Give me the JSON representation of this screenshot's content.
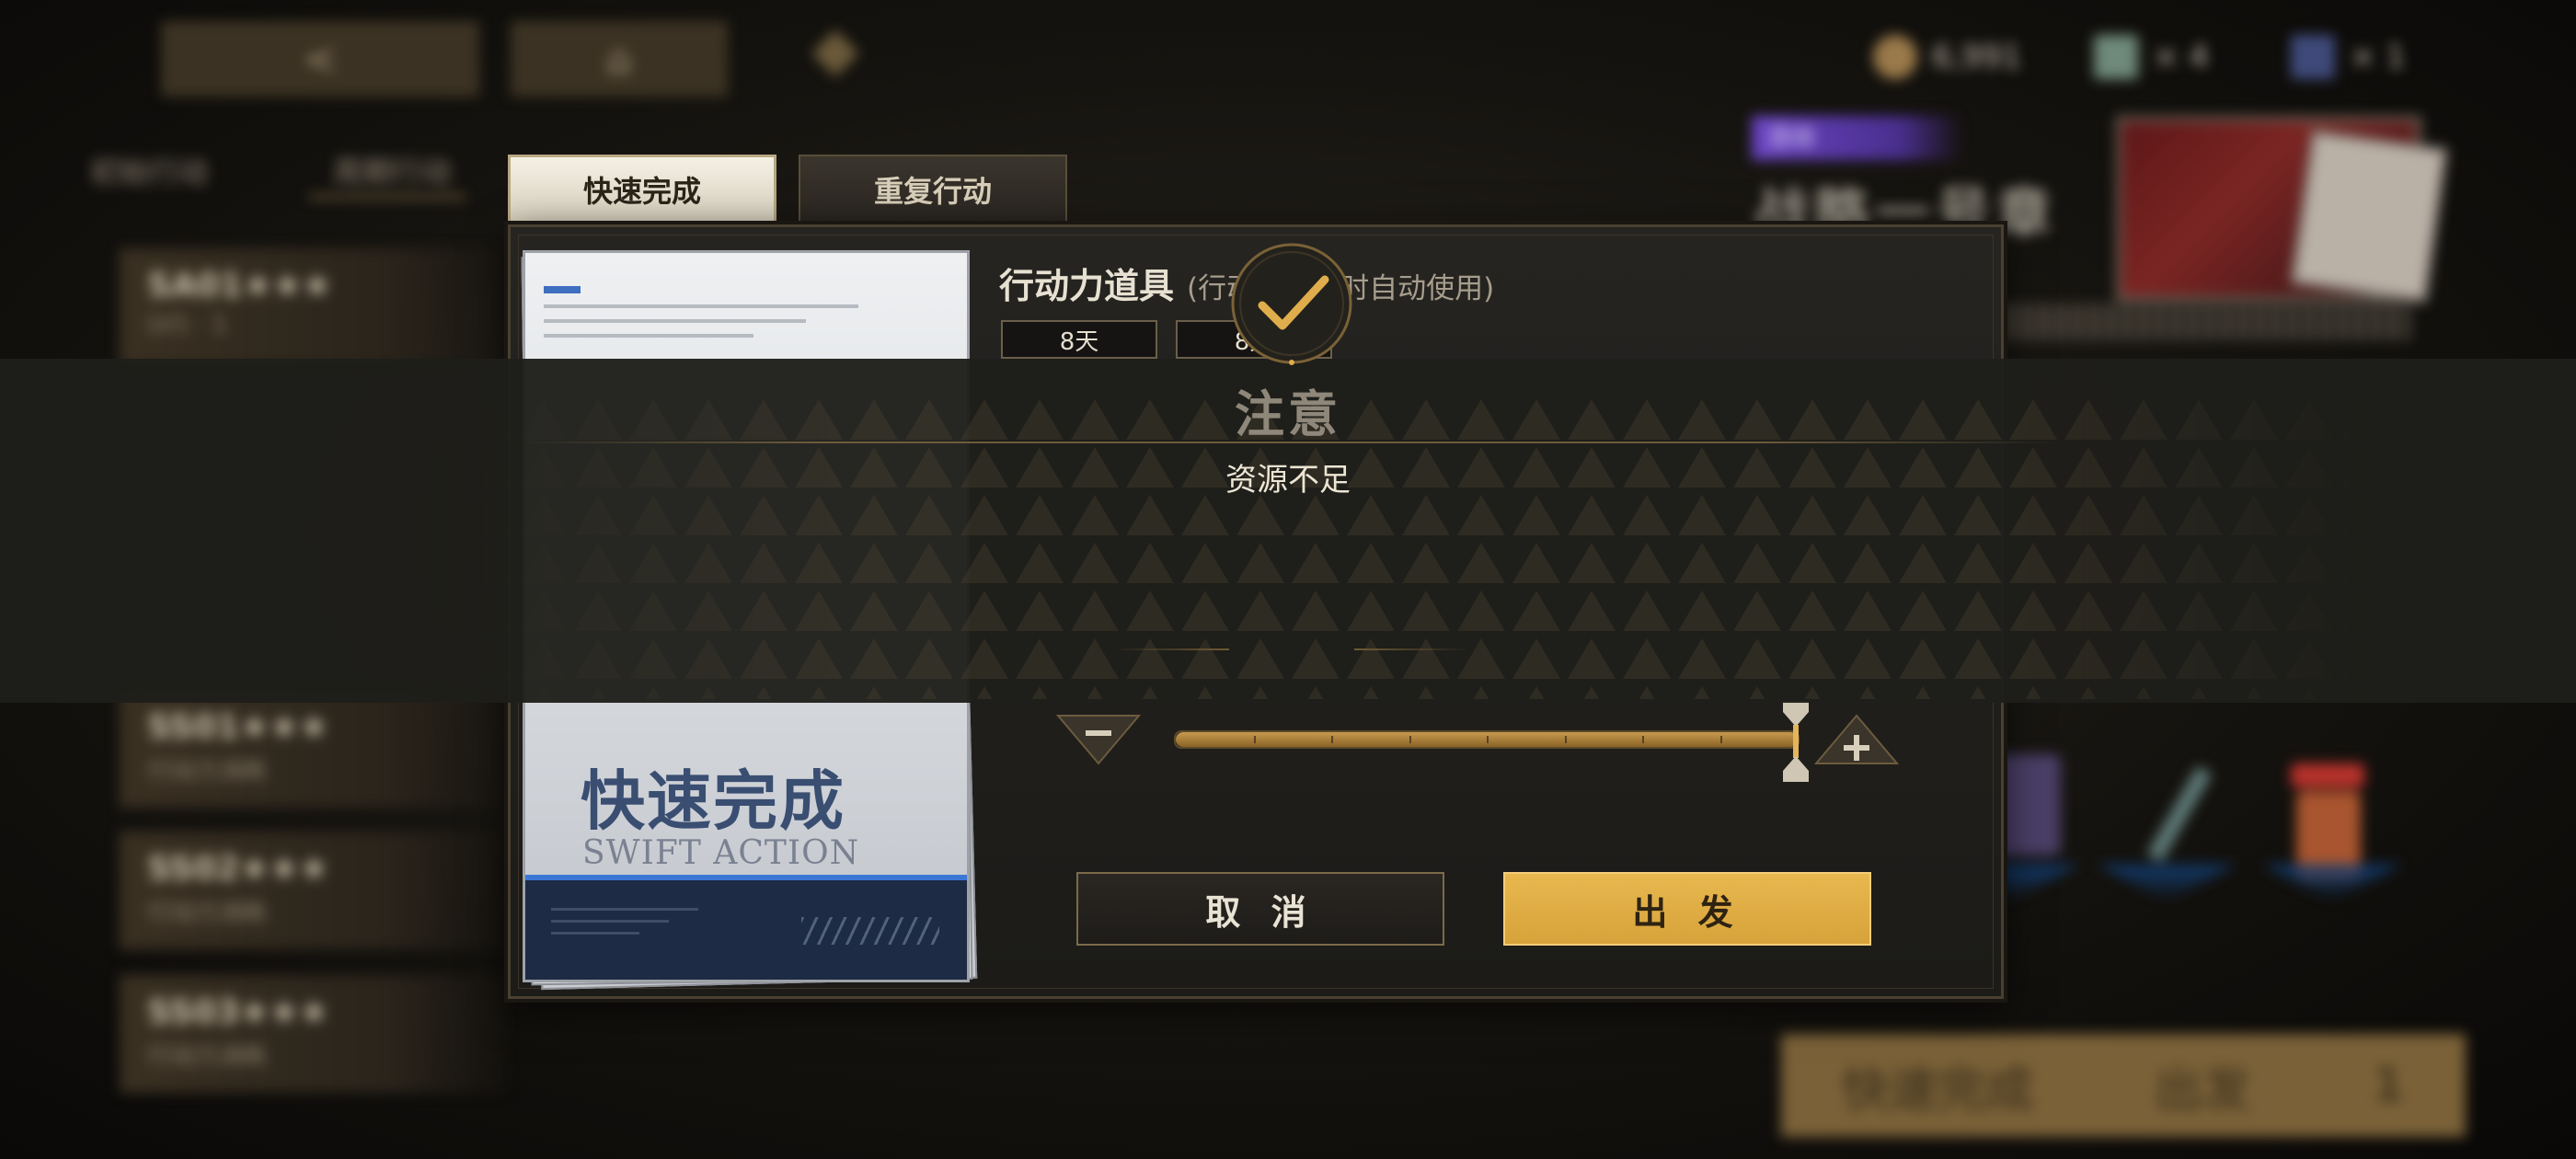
{
  "background": {
    "left_tabs": [
      "初始行动",
      "周期行动"
    ],
    "stages": [
      {
        "name": "SA01★★★",
        "desc": "LV1 · 1"
      },
      {
        "name": "SS01★★★",
        "desc": "行动力消耗"
      },
      {
        "name": "SS02★★★",
        "desc": "行动力消耗"
      },
      {
        "name": "SS03★★★",
        "desc": "行动力消耗"
      }
    ],
    "resources": [
      "6,991",
      "× 4",
      "× 1"
    ],
    "event_tag": "活动",
    "event_title": "战略一号章",
    "bottom_bar": {
      "left": "快速完成",
      "right": "出发",
      "count": "1"
    }
  },
  "tabs": [
    {
      "label": "快速完成",
      "active": true
    },
    {
      "label": "重复行动",
      "active": false
    }
  ],
  "card": {
    "title_cn": "快速完成",
    "title_en": "SWIFT ACTION"
  },
  "item_section": {
    "title": "行动力道具",
    "subtitle": "(行动力不够时自动使用)",
    "durations": [
      "8天",
      "8天"
    ]
  },
  "slider": {
    "value": 1.0,
    "decrement_icon": "minus-icon",
    "increment_icon": "plus-icon"
  },
  "buttons": {
    "cancel": "取 消",
    "confirm": "出 发"
  },
  "alert": {
    "title": "注意",
    "message": "资源不足",
    "confirm_icon": "checkmark-icon"
  },
  "colors": {
    "accent_gold": "#d7a23a",
    "card_blue": "#3d77d6",
    "panel_dark": "#1c1b18"
  }
}
